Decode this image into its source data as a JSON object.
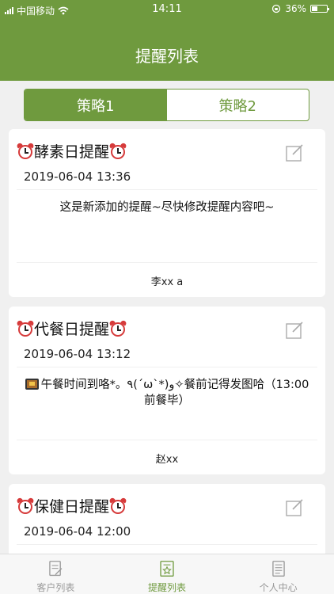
{
  "status_bar": {
    "carrier": "中国移动",
    "time": "14:11",
    "battery": "36%"
  },
  "nav": {
    "title": "提醒列表"
  },
  "segments": [
    {
      "label": "策略1",
      "active": true
    },
    {
      "label": "策略2",
      "active": false
    }
  ],
  "reminders": [
    {
      "title": "酵素日提醒",
      "time": "2019-06-04 13:36",
      "content": "这是新添加的提醒~尽快修改提醒内容吧~",
      "author": "李xx  a"
    },
    {
      "title": "代餐日提醒",
      "time": "2019-06-04 13:12",
      "content": "午餐时间到咯*。٩(ˊωˋ*)و✧餐前记得发图哈（13:00前餐毕）",
      "author": "赵xx"
    },
    {
      "title": "保健日提醒",
      "time": "2019-06-04 12:00",
      "content": "",
      "author": ""
    }
  ],
  "tab_bar": [
    {
      "label": "客户列表",
      "icon": "document-icon",
      "active": false
    },
    {
      "label": "提醒列表",
      "icon": "reminder-star-icon",
      "active": true
    },
    {
      "label": "个人中心",
      "icon": "profile-document-icon",
      "active": false
    }
  ],
  "colors": {
    "primary": "#6f9a3e",
    "alarm": "#d63a3a"
  }
}
